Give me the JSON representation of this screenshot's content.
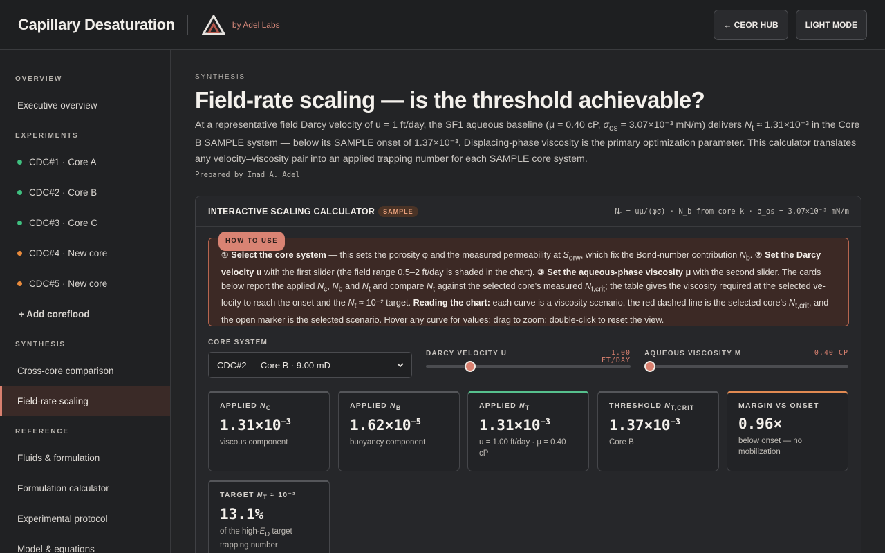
{
  "header": {
    "app_title": "Capillary Desaturation",
    "byline": "by Adel Labs",
    "hub_button": "← CEOR HUB",
    "mode_button": "LIGHT MODE"
  },
  "sidebar": {
    "overview_head": "OVERVIEW",
    "overview_items": [
      {
        "label": "Executive overview"
      }
    ],
    "experiments_head": "EXPERIMENTS",
    "experiments": [
      {
        "label": "CDC#1 · Core A",
        "status_color": "#3fbf7f"
      },
      {
        "label": "CDC#2 · Core B",
        "status_color": "#3fbf7f"
      },
      {
        "label": "CDC#3 · Core C",
        "status_color": "#3fbf7f"
      },
      {
        "label": "CDC#4 · New core",
        "status_color": "#e88a3c"
      },
      {
        "label": "CDC#5 · New core",
        "status_color": "#e88a3c"
      }
    ],
    "add_label": "+ Add coreflood",
    "synthesis_head": "SYNTHESIS",
    "synthesis_items": [
      {
        "label": "Cross-core comparison"
      },
      {
        "label": "Field-rate scaling"
      }
    ],
    "reference_head": "REFERENCE",
    "reference_items": [
      {
        "label": "Fluids & formulation"
      },
      {
        "label": "Formulation calculator"
      },
      {
        "label": "Experimental protocol"
      },
      {
        "label": "Model & equations"
      }
    ]
  },
  "main": {
    "eyebrow": "SYNTHESIS",
    "title": "Field-rate scaling — is the threshold achievable?",
    "lead_1": "At a representative field Darcy velocity of u = 1 ft/day, the SF1 aqueous baseline (μ = 0.40 cP, ",
    "lead_sigma": "σ",
    "lead_sigma_sub": "os",
    "lead_2": " = 3.07×10⁻³ mN/m) delivers ",
    "lead_nt": "N",
    "lead_nt_sub": "t",
    "lead_3": " ≈ 1.31×10⁻³ in the Core B SAMPLE system — below its SAMPLE onset of 1.37×10⁻³. Displacing-phase viscosity is the primary optimization parameter. This calculator translates any velocity–viscosity pair into an applied trapping number for each SAMPLE core system.",
    "prepared": "Prepared by Imad A. Adel"
  },
  "calculator": {
    "title": "INTERACTIVE SCALING CALCULATOR",
    "badge": "SAMPLE",
    "formula": "N꜀ = uμ/(φσ) · N_b from core k · σ_os = 3.07×10⁻³ mN/m",
    "howto_tag": "HOW TO USE",
    "howto_b1": "① Select the core system",
    "howto_t1": " — this sets the porosity φ and the measured permeability at ",
    "howto_s": "S",
    "howto_s_sub": "orw",
    "howto_t1b": ", which fix the Bond-number contribution ",
    "howto_nb": "N",
    "howto_nb_sub": "b",
    "howto_t1c": ". ",
    "howto_b2": "② Set the Darcy velocity u",
    "howto_t2": " with the first slider (the field range 0.5–2 ft/day is shaded in the chart). ",
    "howto_b3": "③ Set the aqueous-phase viscosity μ",
    "howto_t3": " with the second slider. The cards below report the applied ",
    "howto_nc": "N",
    "howto_nc_sub": "c",
    "howto_t3b": ", ",
    "howto_nb2": "N",
    "howto_nb2_sub": "b",
    "howto_t3c": " and ",
    "howto_nt": "N",
    "howto_nt_sub": "t",
    "howto_t3d": " and compare ",
    "howto_nt2": "N",
    "howto_nt2_sub": "t",
    "howto_t3e": " against the selected core's measured ",
    "howto_ntc": "N",
    "howto_ntc_sub": "t,crit",
    "howto_t3f": "; the table gives the viscosity required at the selected ve-locity to reach the onset and the ",
    "howto_nt3": "N",
    "howto_nt3_sub": "t",
    "howto_t3g": " ≈ 10⁻² target. ",
    "howto_b4": "Reading the chart:",
    "howto_t4": " each curve is a viscosity scenario, the red dashed line is the selected core's ",
    "howto_ntc2": "N",
    "howto_ntc2_sub": "t,crit",
    "howto_t4b": ", and the open marker is the selected scenario. Hover any curve for values; drag to zoom; double-click to reset the view.",
    "core_label": "CORE SYSTEM",
    "core_value": "CDC#2 — Core B · 9.00 mD",
    "velocity_label": "DARCY VELOCITY U",
    "velocity_value": "1.00 FT/DAY",
    "velocity_fraction": 0.2,
    "viscosity_label": "AQUEOUS VISCOSITY Μ",
    "viscosity_value": "0.40 CP",
    "viscosity_fraction": 0.0,
    "cards": [
      {
        "label": "APPLIED ",
        "label_var": "N",
        "label_sub": "C",
        "mantissa": "1.31×10",
        "exponent": "−3",
        "sub": "viscous component"
      },
      {
        "label": "APPLIED ",
        "label_var": "N",
        "label_sub": "B",
        "mantissa": "1.62×10",
        "exponent": "−5",
        "sub": "buoyancy component"
      },
      {
        "label": "APPLIED ",
        "label_var": "N",
        "label_sub": "T",
        "mantissa": "1.31×10",
        "exponent": "−3",
        "sub": "u = 1.00 ft/day · μ = 0.40 cP"
      },
      {
        "label": "THRESHOLD ",
        "label_var": "N",
        "label_sub": "T,CRIT",
        "mantissa": "1.37×10",
        "exponent": "−3",
        "sub": "Core B"
      },
      {
        "label": "MARGIN VS ONSET",
        "label_var": "",
        "label_sub": "",
        "mantissa": "0.96×",
        "exponent": "",
        "sub": "below onset — no mobilization"
      },
      {
        "label": "TARGET ",
        "label_var": "N",
        "label_sub": "T",
        "label_tail": " ≈ 10⁻²",
        "mantissa": "13.1%",
        "exponent": "",
        "sub_1": "of the high-",
        "sub_var": "E",
        "sub_var_sub": "D",
        "sub_2": " target trapping number"
      }
    ]
  }
}
